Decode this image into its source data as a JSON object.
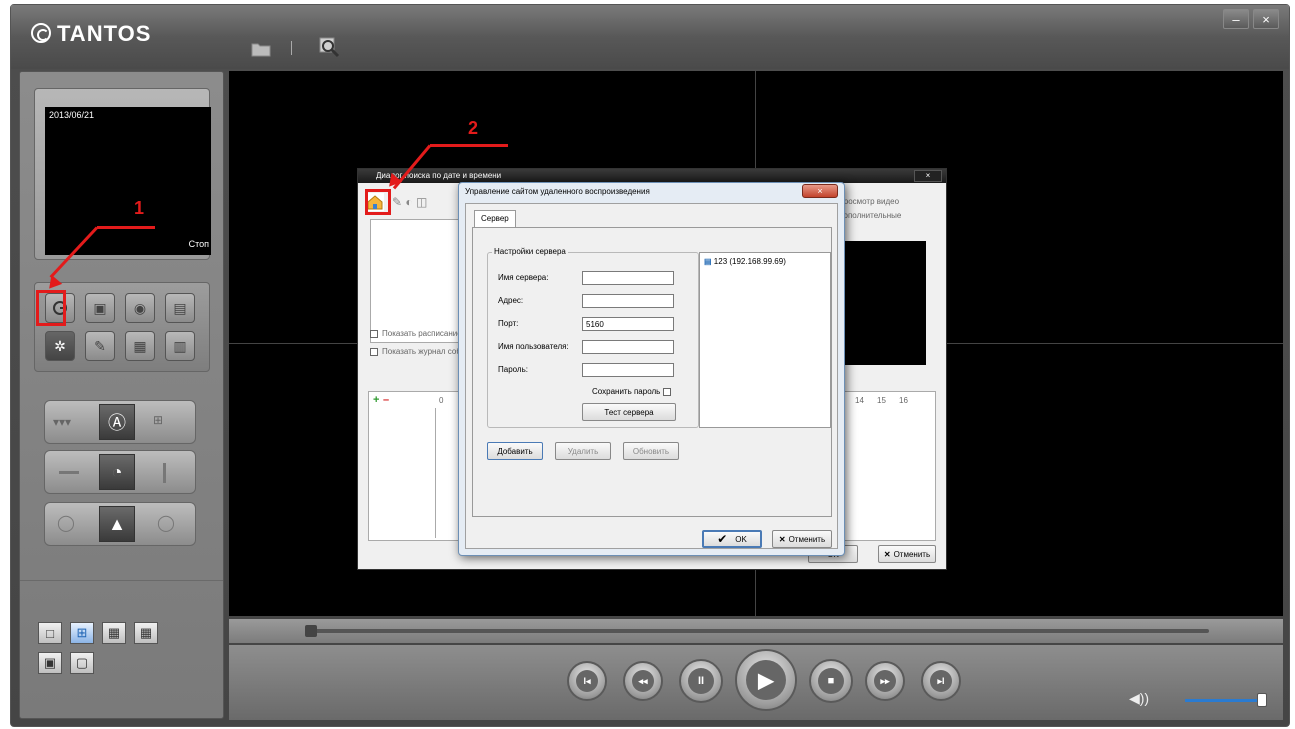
{
  "app": {
    "logo": "TANTOS"
  },
  "toolbar": {
    "folder_icon": "folder-icon",
    "search_icon": "search-icon"
  },
  "window": {
    "minimize": "–",
    "close": "×"
  },
  "preview": {
    "date": "2013/06/21",
    "status": "Стоп"
  },
  "annotations": {
    "label1": "1",
    "label2": "2",
    "color": "#e31b1b"
  },
  "search_dialog": {
    "title": "Диалог поиска по дате и времени",
    "show_schedule": "Показать расписание",
    "show_log": "Показать журнал событий",
    "view_video": "Просмотр видео",
    "extra": "Дополнительные",
    "ruler_ticks": [
      "0",
      "14",
      "15",
      "16"
    ],
    "ok": "OK",
    "cancel": "Отменить"
  },
  "server_dialog": {
    "title": "Управление сайтом удаленного воспроизведения",
    "close_label": "×",
    "tab_server": "Сервер",
    "group_title": "Настройки сервера",
    "fields": {
      "server_name_label": "Имя сервера:",
      "address_label": "Адрес:",
      "port_label": "Порт:",
      "port_value": "5160",
      "username_label": "Имя пользователя:",
      "password_label": "Пароль:"
    },
    "save_password": "Сохранить пароль",
    "test_server": "Тест сервера",
    "servers": [
      "123 (192.168.99.69)"
    ],
    "add": "Добавить",
    "delete": "Удалить",
    "update": "Обновить",
    "ok": "OK",
    "cancel": "Отменить"
  },
  "colors": {
    "accent": "#2a7bd1",
    "highlight": "#e31b1b"
  }
}
